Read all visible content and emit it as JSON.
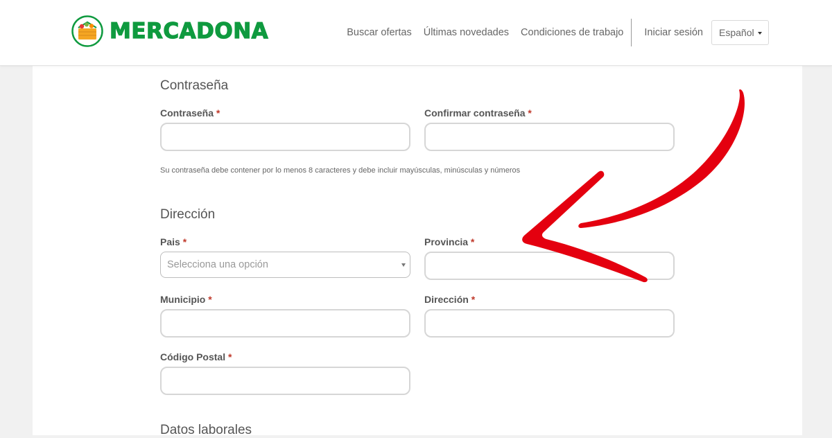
{
  "header": {
    "brand": "MERCADONA",
    "nav": [
      {
        "label": "Buscar ofertas"
      },
      {
        "label": "Últimas novedades"
      },
      {
        "label": "Condiciones de trabajo"
      },
      {
        "label": "Iniciar sesión"
      }
    ],
    "language": "Español"
  },
  "password_section": {
    "title": "Contraseña",
    "password_label": "Contraseña",
    "confirm_label": "Confirmar contraseña",
    "hint": "Su contraseña debe contener por lo menos 8 caracteres y debe incluir mayúsculas, minúsculas y números"
  },
  "address_section": {
    "title": "Dirección",
    "country_label": "Pais",
    "country_placeholder": "Selecciona una opción",
    "province_label": "Provincia",
    "municipality_label": "Municipio",
    "address_label": "Dirección",
    "postal_code_label": "Código Postal"
  },
  "work_section": {
    "title": "Datos laborales"
  },
  "required_marker": "*",
  "colors": {
    "brand_green": "#0f9a3f",
    "required_red": "#c0392b",
    "annotation_arrow": "#e4000f"
  }
}
